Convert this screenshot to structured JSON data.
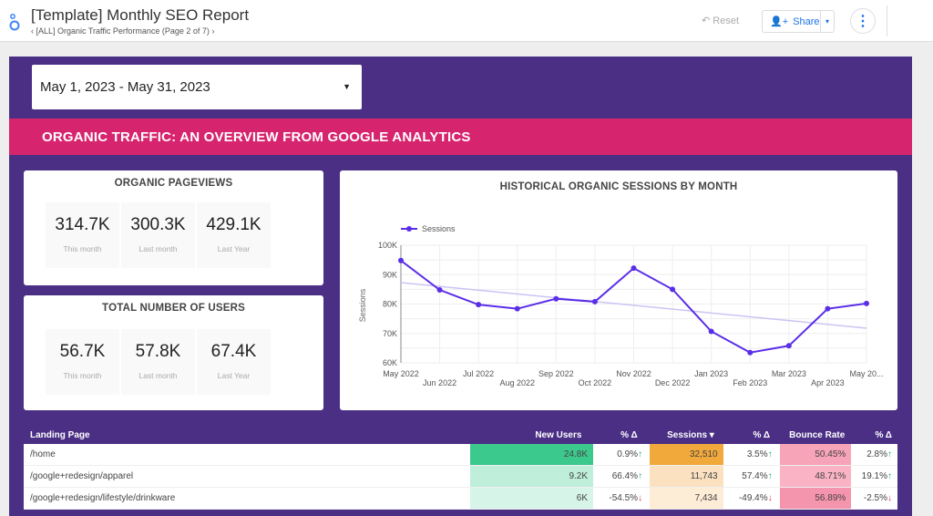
{
  "header": {
    "title": "[Template] Monthly SEO Report",
    "breadcrumb": "[ALL] Organic Traffic Performance (Page 2 of 7)",
    "reset_label": "Reset",
    "share_label": "Share"
  },
  "date_range": "May 1, 2023 - May 31, 2023",
  "banner": "ORGANIC TRAFFIC: AN OVERVIEW FROM GOOGLE ANALYTICS",
  "pageviews": {
    "title": "ORGANIC PAGEVIEWS",
    "items": [
      {
        "value": "314.7K",
        "label": "This month"
      },
      {
        "value": "300.3K",
        "label": "Last month"
      },
      {
        "value": "429.1K",
        "label": "Last Year"
      }
    ]
  },
  "users": {
    "title": "TOTAL NUMBER OF USERS",
    "items": [
      {
        "value": "56.7K",
        "label": "This month"
      },
      {
        "value": "57.8K",
        "label": "Last month"
      },
      {
        "value": "67.4K",
        "label": "Last Year"
      }
    ]
  },
  "chart_data": {
    "type": "line",
    "title": "HISTORICAL ORGANIC SESSIONS BY MONTH",
    "ylabel": "Sessions",
    "xlabel": "",
    "ylim": [
      60000,
      100000
    ],
    "yticks": [
      "60K",
      "70K",
      "80K",
      "90K",
      "100K"
    ],
    "grid": true,
    "legend": "top-left",
    "line_color": "#5a2ee8",
    "trend_color": "#cbc4f5",
    "categories": [
      "May 2022",
      "Jun 2022",
      "Jul 2022",
      "Aug 2022",
      "Sep 2022",
      "Oct 2022",
      "Nov 2022",
      "Dec 2022",
      "Jan 2023",
      "Feb 2023",
      "Mar 2023",
      "Apr 2023",
      "May 20..."
    ],
    "series": [
      {
        "name": "Sessions",
        "values": [
          94800,
          84800,
          79800,
          78400,
          81800,
          80800,
          92200,
          85000,
          70700,
          63500,
          65800,
          78400,
          80200
        ]
      }
    ],
    "trendline": [
      87300,
      71800
    ]
  },
  "table": {
    "headers": [
      "Landing Page",
      "New Users",
      "% Δ",
      "Sessions ▾",
      "% Δ",
      "Bounce Rate",
      "% Δ"
    ],
    "rows": [
      {
        "page": "/home",
        "new_users": "24.8K",
        "nu_delta": "0.9% ↑",
        "sessions": "32,510",
        "s_delta": "3.5% ↑",
        "bounce": "50.45%",
        "b_delta": "2.8% ↑",
        "nu_bg": "#3cc98e",
        "s_bg": "#f2a93b",
        "b_bg": "#f7a3b8",
        "dirs": [
          "up",
          "up",
          "up"
        ]
      },
      {
        "page": "/google+redesign/apparel",
        "new_users": "9.2K",
        "nu_delta": "66.4% ↑",
        "sessions": "11,743",
        "s_delta": "57.4% ↑",
        "bounce": "48.71%",
        "b_delta": "19.1% ↑",
        "nu_bg": "#bfeedb",
        "s_bg": "#fbe1c0",
        "b_bg": "#f9b3c5",
        "dirs": [
          "up",
          "up",
          "up"
        ]
      },
      {
        "page": "/google+redesign/lifestyle/drinkware",
        "new_users": "6K",
        "nu_delta": "-54.5% ↓",
        "sessions": "7,434",
        "s_delta": "-49.4% ↓",
        "bounce": "56.89%",
        "b_delta": "-2.5% ↓",
        "nu_bg": "#d6f4e7",
        "s_bg": "#fdecd6",
        "b_bg": "#f594ad",
        "dirs": [
          "dn",
          "dn",
          "dn"
        ]
      }
    ]
  }
}
